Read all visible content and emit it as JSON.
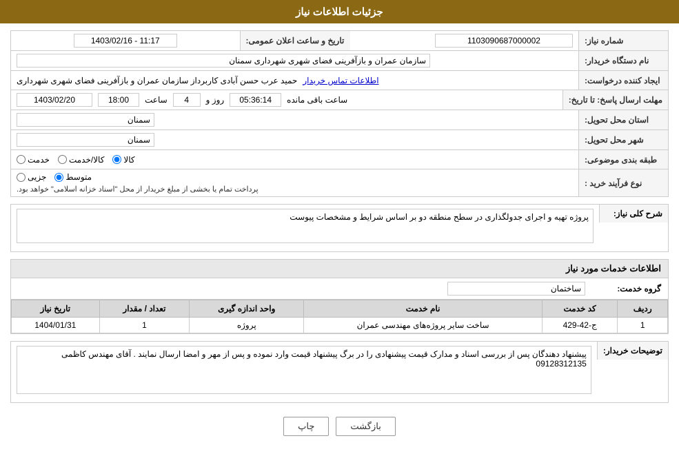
{
  "header": {
    "title": "جزئیات اطلاعات نیاز"
  },
  "fields": {
    "need_number_label": "شماره نیاز:",
    "need_number_value": "1103090687000002",
    "buyer_org_label": "نام دستگاه خریدار:",
    "buyer_org_value": "سازمان عمران و بازآفرینی فضای شهری شهرداری سمنان",
    "creator_label": "ایجاد کننده درخواست:",
    "creator_name": "حمید عرب حسن آبادی کاربرداز سازمان عمران و بازآفرینی فضای شهری شهرداری",
    "creator_link": "اطلاعات تماس خریدار",
    "response_deadline_label": "مهلت ارسال پاسخ: تا تاریخ:",
    "response_date": "1403/02/20",
    "response_time_label": "ساعت",
    "response_time": "18:00",
    "response_days_label": "روز و",
    "response_days": "4",
    "countdown_label": "ساعت باقی مانده",
    "countdown_value": "05:36:14",
    "province_label": "استان محل تحویل:",
    "province_value": "سمنان",
    "city_label": "شهر محل تحویل:",
    "city_value": "سمنان",
    "category_label": "طبقه بندی موضوعی:",
    "category_options": [
      "خدمت",
      "کالا/خدمت",
      "کالا"
    ],
    "category_selected": "کالا",
    "purchase_type_label": "نوع فرآیند خرید :",
    "purchase_options": [
      "جزیی",
      "متوسط"
    ],
    "purchase_selected": "متوسط",
    "purchase_note": "پرداخت تمام یا بخشی از مبلغ خریدار از محل \"اسناد خزانه اسلامی\" خواهد بود.",
    "announcement_label": "تاریخ و ساعت اعلان عمومی:",
    "announcement_value": "1403/02/16 - 11:17"
  },
  "need_description": {
    "section_label": "شرح کلی نیاز:",
    "value": "پروژه تهیه و اجرای جدولگذاری در سطح منطقه دو بر اساس شرایط و مشخصات پیوست"
  },
  "service_info": {
    "section_title": "اطلاعات خدمات مورد نیاز",
    "service_group_label": "گروه خدمت:",
    "service_group_value": "ساختمان"
  },
  "table": {
    "columns": [
      "ردیف",
      "کد خدمت",
      "نام خدمت",
      "واحد اندازه گیری",
      "تعداد / مقدار",
      "تاریخ نیاز"
    ],
    "rows": [
      {
        "row": "1",
        "code": "ج-42-429",
        "name": "ساخت سایر پروژه‌های مهندسی عمران",
        "unit": "پروژه",
        "quantity": "1",
        "date": "1404/01/31"
      }
    ]
  },
  "buyer_notes": {
    "label": "توضیحات خریدار:",
    "value": "پیشنهاد دهندگان پس از بررسی اسناد و مدارک قیمت پیشنهادی را در برگ پیشنهاد قیمت وارد نموده و پس از مهر و امضا ارسال نمایند . آقای مهندس کاظمی 09128312135"
  },
  "buttons": {
    "print": "چاپ",
    "back": "بازگشت"
  }
}
